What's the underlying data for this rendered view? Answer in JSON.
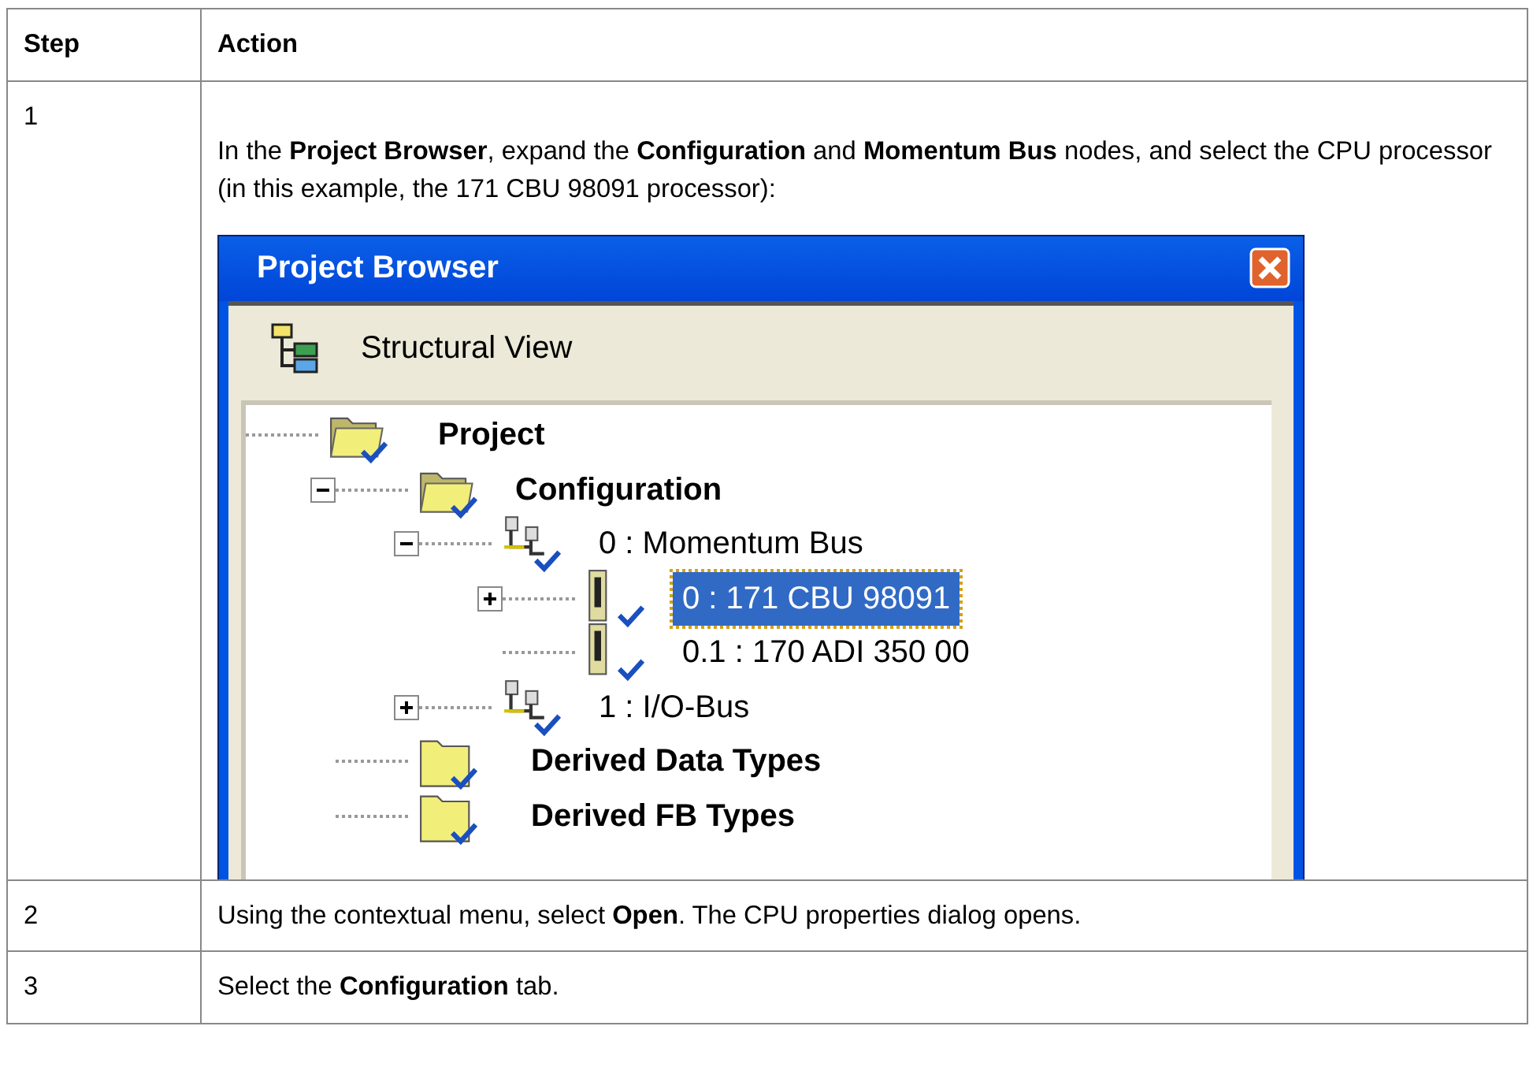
{
  "table": {
    "columns": [
      "Step",
      "Action"
    ],
    "rows": [
      {
        "step": "1",
        "text": "In the **Project Browser**, expand the **Configuration** and **Momentum Bus** nodes, and select the CPU processor (in this example, the 171 CBU 98091 processor):",
        "screenshot": {
          "title": "Project Browser",
          "view_label": "Structural View",
          "tree": [
            {
              "label": "Project",
              "kind": "open-folder",
              "selected": false,
              "children": [
                {
                  "label": "Configuration",
                  "kind": "open-folder",
                  "expanded": true,
                  "selected": false,
                  "children": [
                    {
                      "label": "0 : Momentum Bus",
                      "kind": "bus",
                      "expanded": true,
                      "selected": false,
                      "children": [
                        {
                          "label": "0 : 171 CBU 98091",
                          "kind": "module",
                          "expanded": false,
                          "selected": true
                        },
                        {
                          "label": "0.1 : 170 ADI 350 00",
                          "kind": "module",
                          "selected": false
                        }
                      ]
                    },
                    {
                      "label": "1 : I/O-Bus",
                      "kind": "bus",
                      "expanded": false,
                      "selected": false
                    }
                  ]
                },
                {
                  "label": "Derived Data Types",
                  "kind": "folder",
                  "selected": false
                },
                {
                  "label": "Derived FB Types",
                  "kind": "folder",
                  "selected": false
                }
              ]
            }
          ]
        }
      },
      {
        "step": "2",
        "text": "Using the contextual menu, select **Open**. The CPU properties dialog opens."
      },
      {
        "step": "3",
        "text": "Select the **Configuration** tab."
      }
    ]
  }
}
